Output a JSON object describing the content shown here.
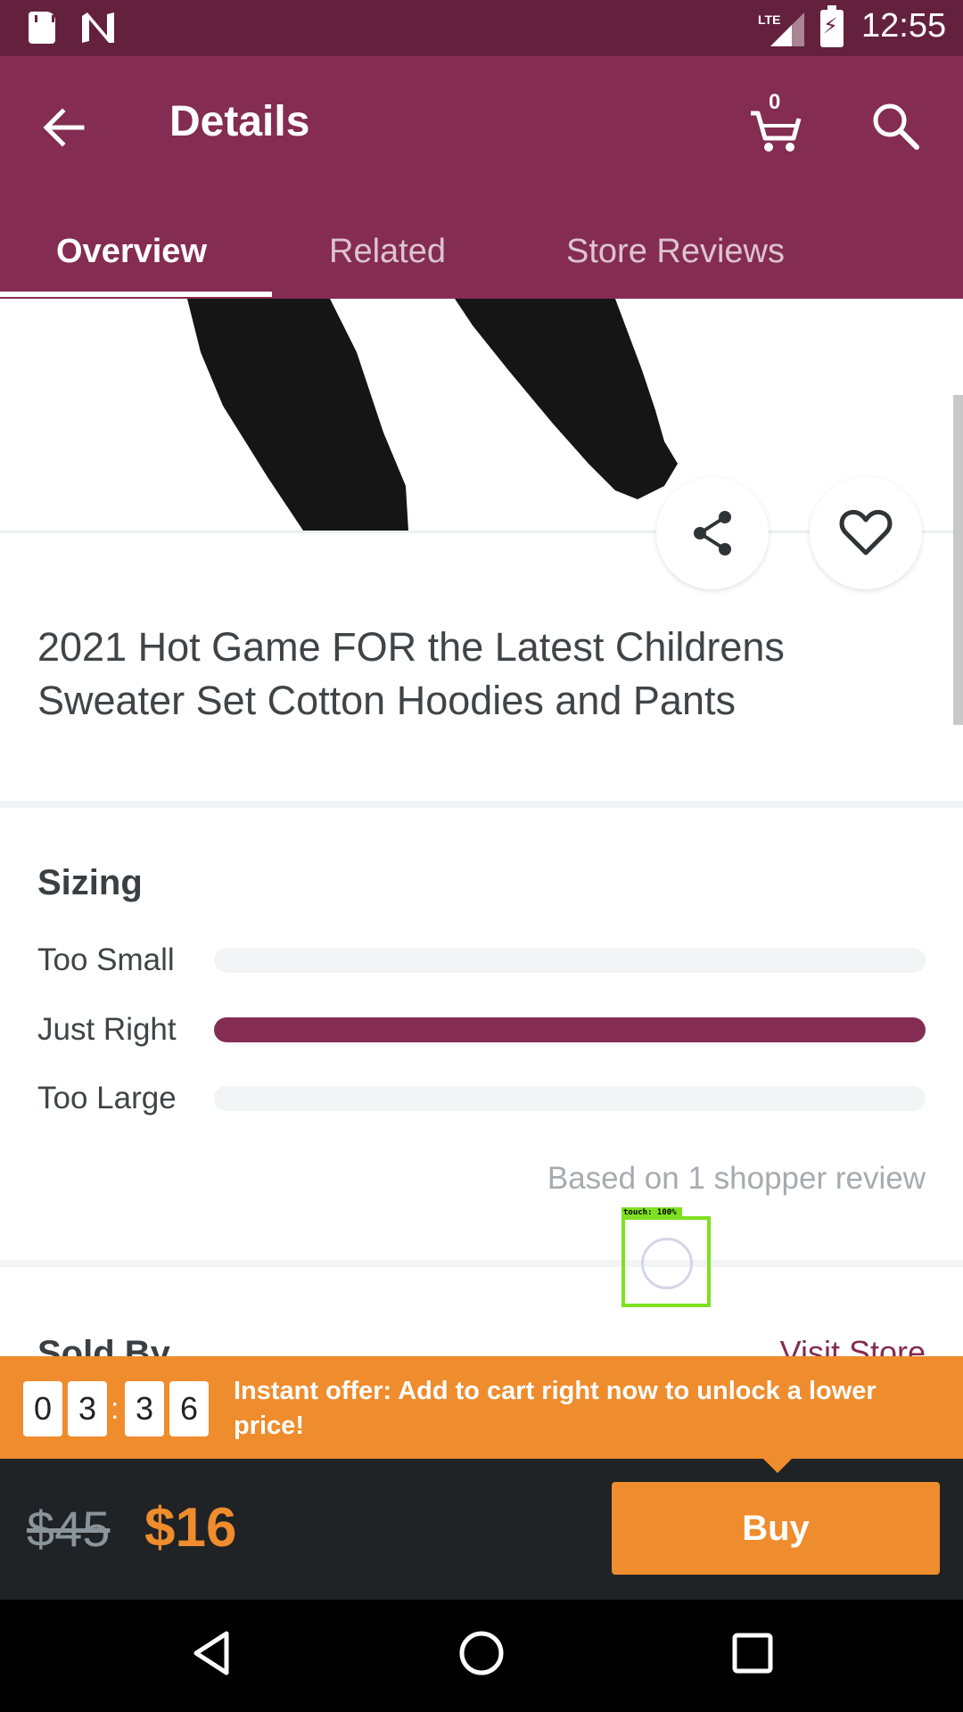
{
  "status_bar": {
    "time": "12:55",
    "network": "LTE"
  },
  "header": {
    "title": "Details",
    "cart_count": "0"
  },
  "tabs": [
    {
      "label": "Overview",
      "active": true
    },
    {
      "label": "Related",
      "active": false
    },
    {
      "label": "Store Reviews",
      "active": false
    }
  ],
  "product": {
    "title": "2021 Hot Game FOR the Latest Childrens Sweater Set Cotton Hoodies and Pants"
  },
  "sizing": {
    "title": "Sizing",
    "rows": [
      {
        "label": "Too Small",
        "fraction": 0.0
      },
      {
        "label": "Just Right",
        "fraction": 1.0
      },
      {
        "label": "Too Large",
        "fraction": 0.0
      }
    ],
    "based_on": "Based on 1 shopper review"
  },
  "sold_by": {
    "title": "Sold By",
    "visit_store": "Visit Store"
  },
  "touch_overlay": {
    "label": "touch: 100%"
  },
  "offer": {
    "countdown_digits": [
      "0",
      "3",
      "3",
      "6"
    ],
    "separator": ":",
    "text": "Instant offer: Add to cart right now to unlock a lower price!"
  },
  "price": {
    "original": "$45",
    "current": "$16",
    "buy_label": "Buy"
  },
  "colors": {
    "brand": "#842c51",
    "status": "#64213d",
    "accent": "#ef8c2d",
    "footer": "#1f2326"
  },
  "icons": [
    "sd-card-icon",
    "n-notification-icon",
    "lte-signal-icon",
    "battery-charging-icon",
    "back-arrow-icon",
    "cart-icon",
    "search-icon",
    "share-icon",
    "heart-icon",
    "nav-back-icon",
    "nav-home-icon",
    "nav-recents-icon"
  ]
}
